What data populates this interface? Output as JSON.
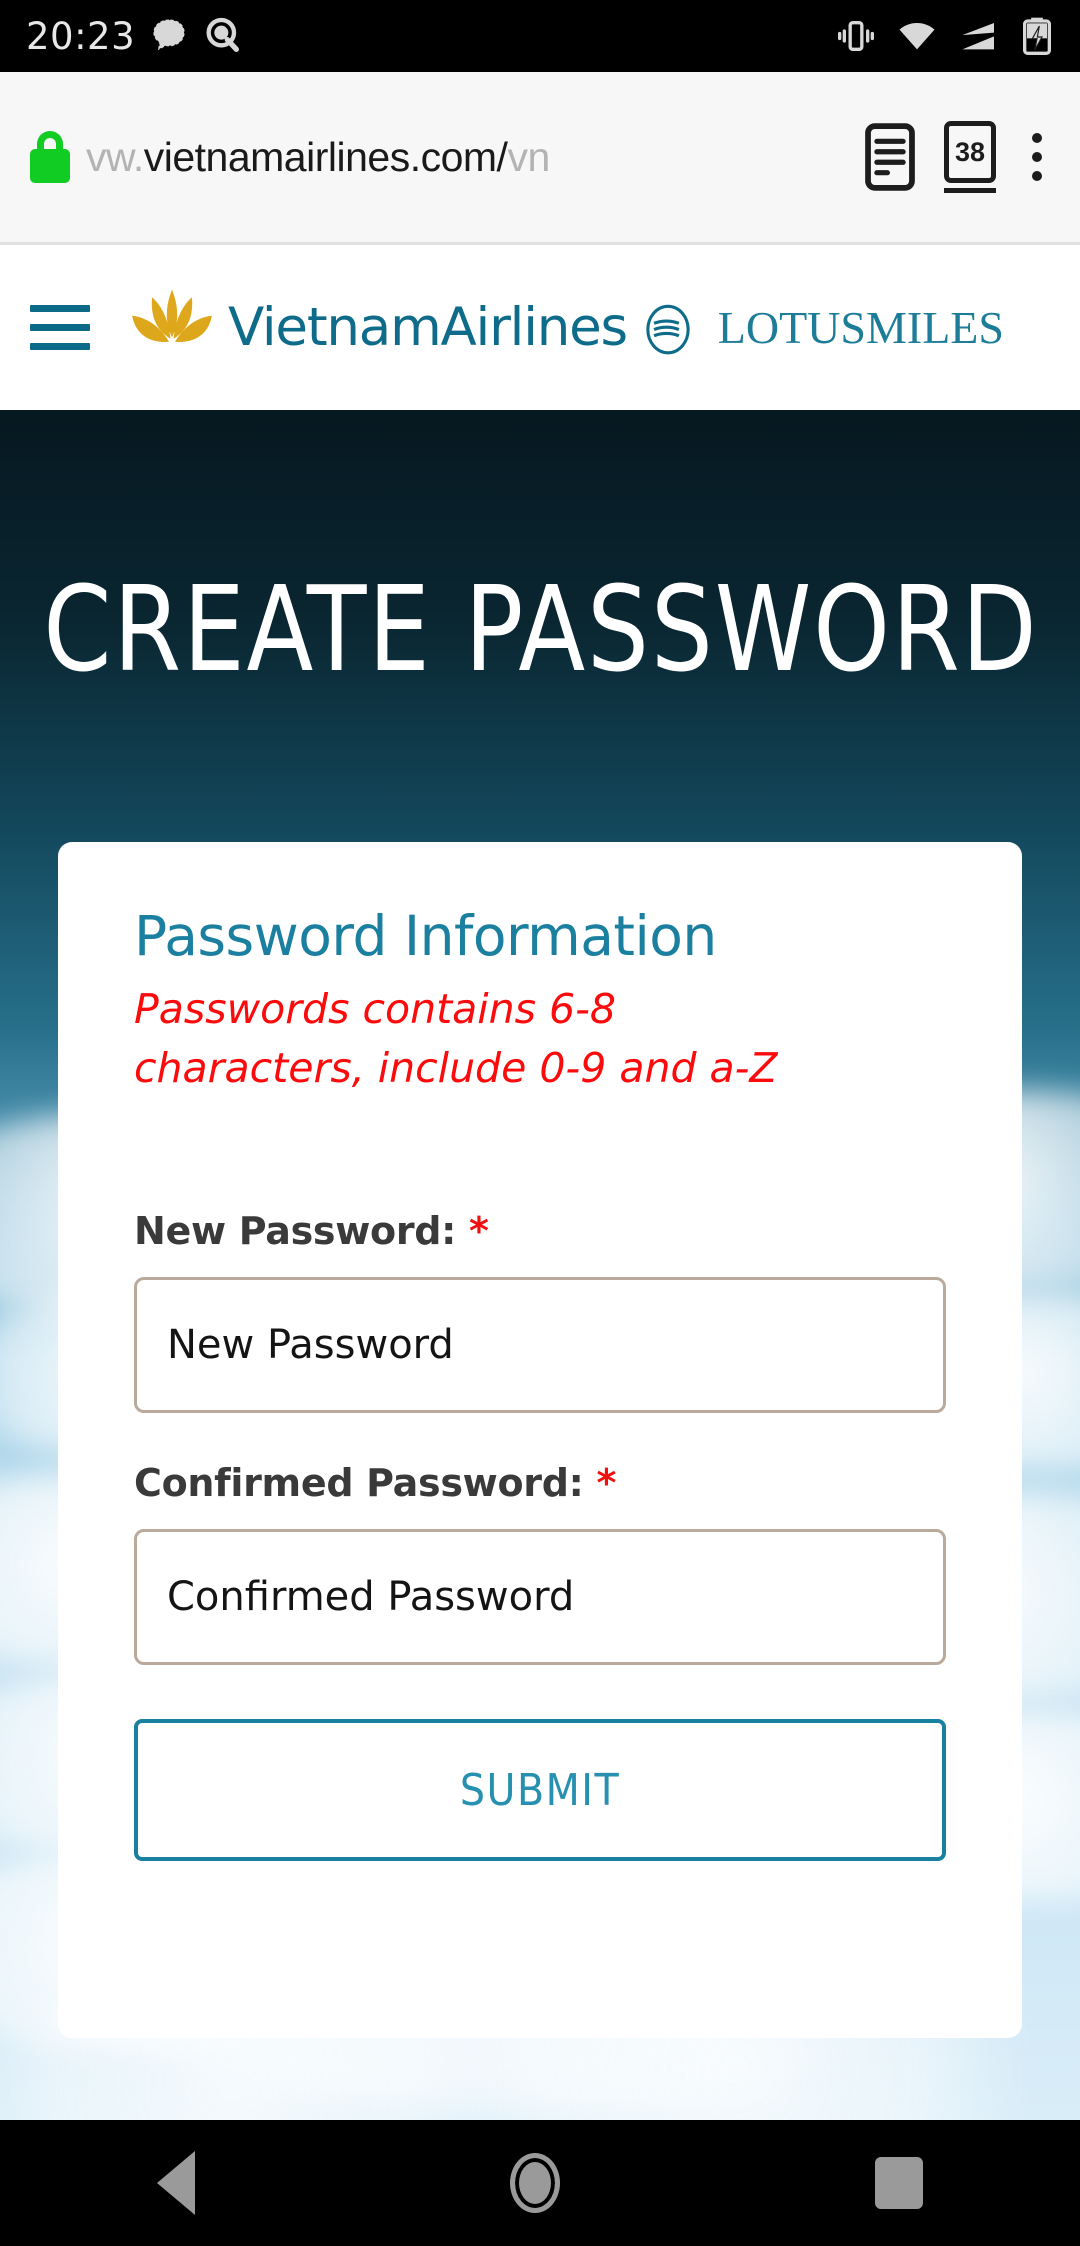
{
  "status_bar": {
    "clock": "20:23",
    "left_icons": [
      "message-bubble-icon",
      "search-bubble-icon"
    ],
    "right_icons": [
      "vibrate-icon",
      "wifi-icon",
      "signal-icon",
      "battery-charging-icon"
    ]
  },
  "browser": {
    "security_icon": "green-lock-icon",
    "url_prefix": "vw.",
    "url_main": "vietnamairlines.com/",
    "url_suffix": "vn",
    "reader_icon": "reader-mode-icon",
    "tab_count": "38",
    "menu_icon": "kebab-menu-icon"
  },
  "site_header": {
    "menu_icon": "hamburger-menu-icon",
    "brand": "VietnamAirlines",
    "skyteam_icon": "skyteam-icon",
    "program_logo": "LOTUSMILES"
  },
  "hero": {
    "title": "CREATE PASSWORD"
  },
  "card": {
    "title": "Password Information",
    "hint": "Passwords contains 6-8 characters, include 0-9 and a-Z",
    "fields": [
      {
        "label": "New Password:",
        "required_mark": "*",
        "placeholder": "New Password",
        "value": ""
      },
      {
        "label": "Confirmed Password:",
        "required_mark": "*",
        "placeholder": "Confirmed Password",
        "value": ""
      }
    ],
    "submit_label": "SUBMIT"
  },
  "nav_bar": {
    "back": "back-icon",
    "home": "home-icon",
    "recents": "recents-icon"
  },
  "colors": {
    "brand_teal": "#0e6b8a",
    "accent_teal": "#1b7fa0",
    "lotus_gold": "#e0a81e",
    "error_red": "#fb0b0b",
    "input_border": "#b9aa9b",
    "lock_green": "#11cc22"
  }
}
